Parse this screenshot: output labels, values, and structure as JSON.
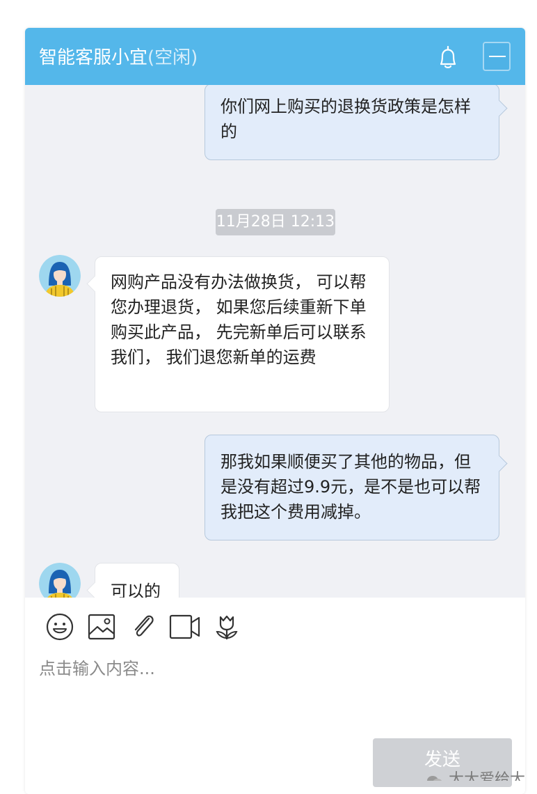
{
  "header": {
    "title": "智能客服小宜",
    "status": "(空闲)",
    "bell_icon": "bell-icon",
    "minimize_icon": "minimize-icon"
  },
  "colors": {
    "header_bg": "#54b7ea",
    "chat_bg": "#f0f1f5",
    "user_bubble_bg": "#e2ecfa",
    "agent_bubble_bg": "#ffffff",
    "timestamp_bg": "#c9cbd0",
    "send_bg": "#cfd1d5"
  },
  "messages": {
    "m1": "你们网上购买的退换货政策是怎样的",
    "timestamp": "11月28日 12:13",
    "m2": "网购产品没有办法做换货， 可以帮您办理退货， 如果您后续重新下单购买此产品， 先完新单后可以联系我们， 我们退您新单的运费",
    "m3": "那我如果顺便买了其他的物品，但是没有超过9.9元，是不是也可以帮我把这个费用减掉。",
    "m4": "可以的"
  },
  "composer": {
    "tools": [
      "emoji-icon",
      "image-icon",
      "attachment-icon",
      "video-icon",
      "flower-icon"
    ],
    "placeholder": "点击输入内容...",
    "send_label": "发送"
  },
  "watermark": {
    "icon": "wechat-icon",
    "text": "大大爱给大"
  }
}
